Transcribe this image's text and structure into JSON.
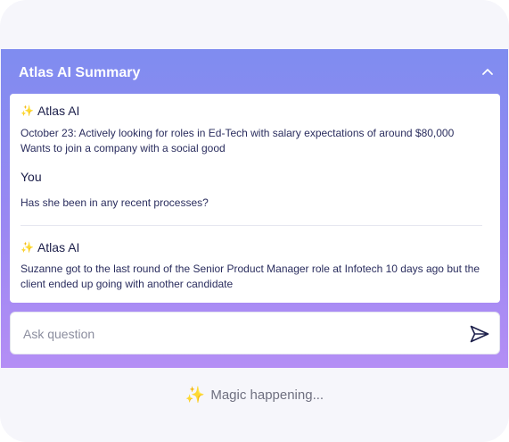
{
  "header": {
    "title": "Atlas AI Summary"
  },
  "messages": [
    {
      "sender": "Atlas AI",
      "text": "October 23: Actively looking for roles in Ed-Tech with salary expectations of around $80,000 Wants to join a company with a social good"
    },
    {
      "sender": "You",
      "text": "Has she been in any recent processes?"
    },
    {
      "sender": "Atlas AI",
      "text": "Suzanne got to the last round of the Senior Product Manager role at Infotech 10 days ago but the client ended up going with another candidate"
    }
  ],
  "input": {
    "placeholder": "Ask question",
    "value": ""
  },
  "status": {
    "text": "Magic happening..."
  },
  "icons": {
    "header_toggle": "chevron-up-icon",
    "ai_badge": "sparkle-icon",
    "send": "send-icon",
    "status": "sparkle-icon"
  },
  "colors": {
    "panel_gradient_top": "#7f8cf0",
    "panel_gradient_bottom": "#b48ef5",
    "text_primary": "#1c1f4a",
    "sparkle": "#f0b93a"
  }
}
